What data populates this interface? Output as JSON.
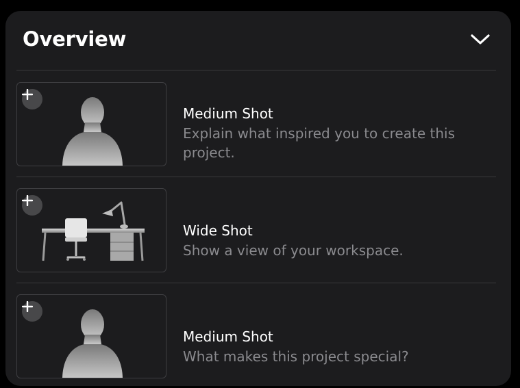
{
  "overview": {
    "title": "Overview",
    "collapse_icon": "chevron-down-icon"
  },
  "shots": [
    {
      "title": "Medium Shot",
      "description": "Explain what inspired you to create this project.",
      "thumbnail": "person-silhouette",
      "add_icon": "plus-icon"
    },
    {
      "title": "Wide Shot",
      "description": "Show a view of your workspace.",
      "thumbnail": "desk-workspace",
      "add_icon": "plus-icon"
    },
    {
      "title": "Medium Shot",
      "description": "What makes this project special?",
      "thumbnail": "person-silhouette",
      "add_icon": "plus-icon"
    }
  ]
}
